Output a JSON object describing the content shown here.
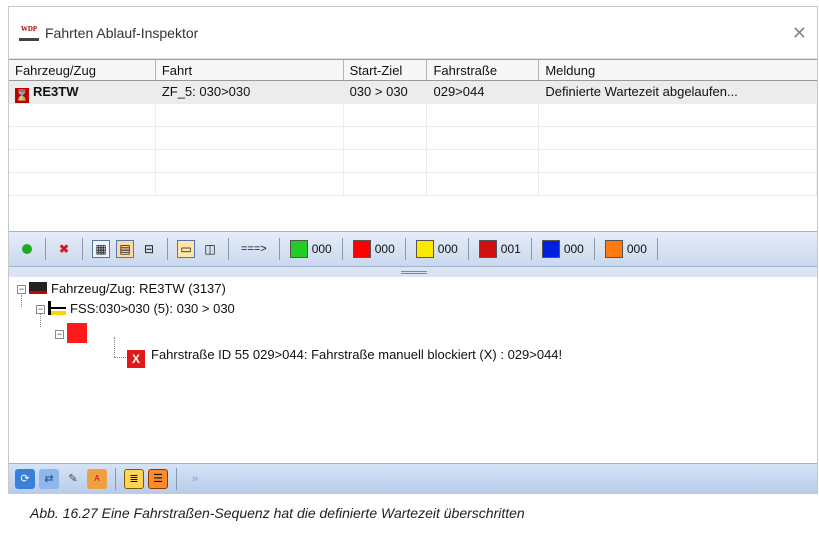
{
  "window": {
    "title": "Fahrten Ablauf-Inspektor",
    "logo_text": "WDP"
  },
  "grid": {
    "columns": [
      "Fahrzeug/Zug",
      "Fahrt",
      "Start-Ziel",
      "Fahrstraße",
      "Meldung"
    ],
    "rows": [
      {
        "train": "RE3TW",
        "fahrt": "ZF_5: 030>030",
        "start_ziel": "030 > 030",
        "fahrstrasse": "029>044",
        "meldung": "Definierte Wartezeit abgelaufen..."
      }
    ]
  },
  "toolbar": {
    "arrow_label": "===>",
    "counters": [
      {
        "name": "green",
        "color": "#22cc22",
        "value": "000"
      },
      {
        "name": "red",
        "color": "#ff0000",
        "value": "000"
      },
      {
        "name": "yellow",
        "color": "#ffe800",
        "value": "000"
      },
      {
        "name": "hourglass",
        "color": "#d01010",
        "value": "001"
      },
      {
        "name": "blue",
        "color": "#0020e0",
        "value": "000"
      },
      {
        "name": "orange",
        "color": "#ff7a10",
        "value": "000"
      }
    ]
  },
  "tree": {
    "root": "Fahrzeug/Zug: RE3TW (3137)",
    "fss": "FSS:030>030 (5): 030 > 030",
    "error_prefix": "X",
    "error": "Fahrstraße ID 55 029>044: Fahrstraße manuell blockiert (X) : 029>044!"
  },
  "caption": "Abb. 16.27  Eine Fahrstraßen-Sequenz hat die definierte Wartezeit überschritten"
}
